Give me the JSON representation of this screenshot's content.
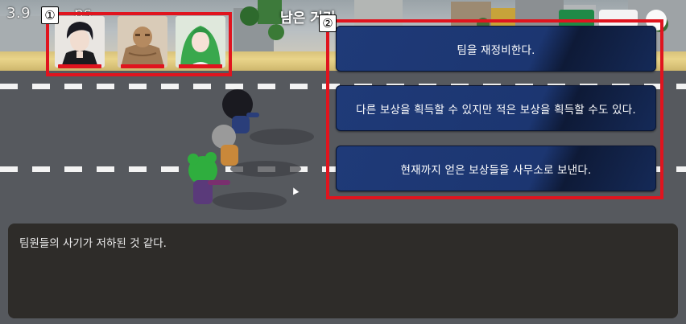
{
  "hud": {
    "left_value": "3.9",
    "left_trail": "ps",
    "title": "남은 거리"
  },
  "markers": {
    "one": "①",
    "two": "②"
  },
  "team": {
    "members": [
      {
        "id": "dark-haired-man"
      },
      {
        "id": "stone-golem"
      },
      {
        "id": "green-haired-girl"
      }
    ]
  },
  "choices": [
    {
      "label": "팀을 재정비한다."
    },
    {
      "label": "다른 보상을 획득할 수 있지만 적은 보상을 획득할 수도 있다."
    },
    {
      "label": "현재까지 얻은 보상들을 사무소로 보낸다."
    }
  ],
  "dialogue": {
    "text": "팀원들의 사기가 저하된 것 같다."
  },
  "colors": {
    "highlight": "#e0141e",
    "choice_bg": "#1f3a78",
    "dialogue_bg": "#2e2c29"
  }
}
